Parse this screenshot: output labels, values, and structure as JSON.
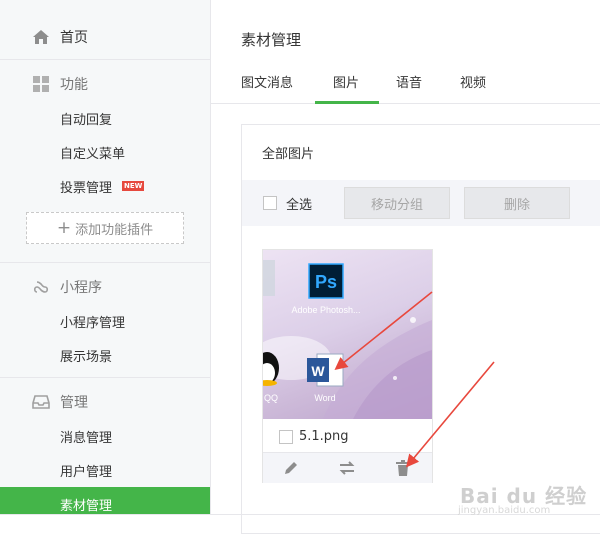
{
  "sidebar": {
    "home": "首页",
    "functions": "功能",
    "function_items": [
      "自动回复",
      "自定义菜单",
      "投票管理"
    ],
    "new_badge": "NEW",
    "add_plugin": "添加功能插件",
    "mini_program": "小程序",
    "mini_program_items": [
      "小程序管理",
      "展示场景"
    ],
    "manage": "管理",
    "manage_items": [
      "消息管理",
      "用户管理",
      "素材管理"
    ],
    "active_item": "素材管理"
  },
  "main": {
    "title": "素材管理",
    "tabs": [
      "图文消息",
      "图片",
      "语音",
      "视频"
    ],
    "active_tab": "图片",
    "panel_title": "全部图片",
    "select_all": "全选",
    "move_group": "移动分组",
    "delete": "删除"
  },
  "image_card": {
    "file_name": "5.1.png",
    "thumb_icons": [
      "Adobe Photosh...",
      "QQ",
      "Word"
    ],
    "actions": [
      "edit-icon",
      "move-icon",
      "trash-icon"
    ]
  },
  "watermark": {
    "text": "Bai du 经验",
    "url": "jingyan.baidu.com"
  },
  "colors": {
    "accent": "#44b549",
    "arrow": "#e8483d",
    "new_badge": "#e6493e"
  }
}
